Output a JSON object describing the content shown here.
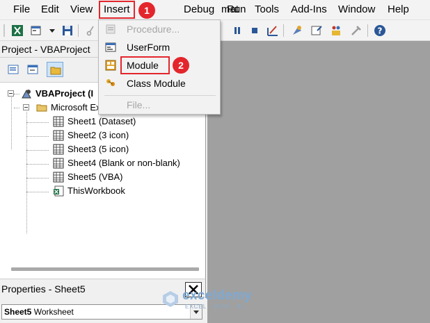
{
  "menubar": {
    "items": [
      "File",
      "Edit",
      "View",
      "Insert",
      "Format",
      "Debug",
      "Run",
      "Tools",
      "Add-Ins",
      "Window",
      "Help"
    ],
    "visible_format_fragment": "mat"
  },
  "project_pane": {
    "title": "Project - VBAProject",
    "tree": {
      "root": "VBAProject (I",
      "folder": "Microsoft Ex",
      "sheets": [
        "Sheet1 (Dataset)",
        "Sheet2 (3 icon)",
        "Sheet3 (5 icon)",
        "Sheet4 (Blank or non-blank)",
        "Sheet5 (VBA)"
      ],
      "workbook": "ThisWorkbook"
    }
  },
  "properties_pane": {
    "title": "Properties - Sheet5",
    "object_name": "Sheet5",
    "object_type": "Worksheet"
  },
  "insert_menu": {
    "items": [
      {
        "label": "Procedure...",
        "icon": "procedure-icon",
        "enabled": false
      },
      {
        "label": "UserForm",
        "icon": "userform-icon",
        "enabled": true
      },
      {
        "label": "Module",
        "icon": "module-icon",
        "enabled": true
      },
      {
        "label": "Class Module",
        "icon": "class-module-icon",
        "enabled": true
      },
      {
        "label": "File...",
        "icon": "",
        "enabled": false
      }
    ]
  },
  "callouts": {
    "step1": "1",
    "step2": "2"
  },
  "watermark": {
    "name": "exceldemy",
    "tagline": "EXCEL · DATA · BI"
  },
  "colors": {
    "callout": "#e3262c",
    "code_area": "#a0a0a0",
    "menu_bg": "#f2f2f2"
  }
}
